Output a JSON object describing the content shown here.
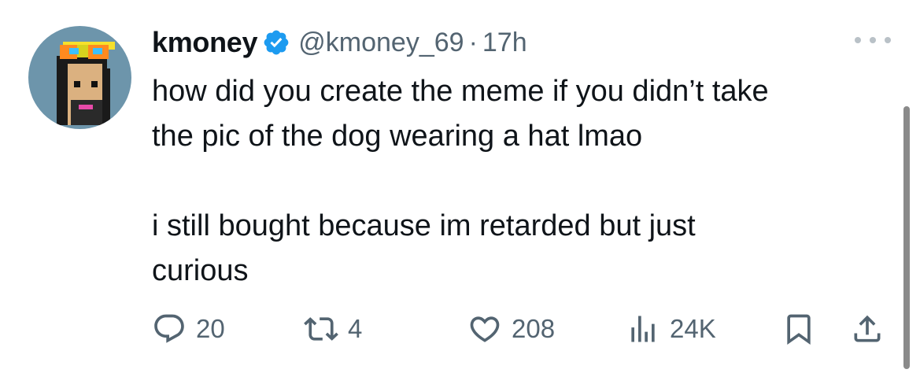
{
  "tweet": {
    "author": {
      "display_name": "kmoney",
      "handle": "@kmoney_69",
      "verified_icon": "verified-badge-icon",
      "avatar": "pixel-art-punk-with-sunglasses"
    },
    "separator": "·",
    "time": "17h",
    "text": "how did you create the meme if you didn’t take\nthe pic of the dog wearing a hat lmao\n\ni still bought because im retarded but just\ncurious",
    "actions": {
      "reply": {
        "icon": "reply-icon",
        "count": "20"
      },
      "retweet": {
        "icon": "retweet-icon",
        "count": "4"
      },
      "like": {
        "icon": "heart-icon",
        "count": "208"
      },
      "views": {
        "icon": "views-chart-icon",
        "count": "24K"
      },
      "bookmark": {
        "icon": "bookmark-icon"
      },
      "share": {
        "icon": "share-icon"
      }
    }
  },
  "colors": {
    "text_primary": "#0f1419",
    "text_secondary": "#536471",
    "verified_blue": "#1d9bf0",
    "avatar_background": "#6d95ab"
  }
}
